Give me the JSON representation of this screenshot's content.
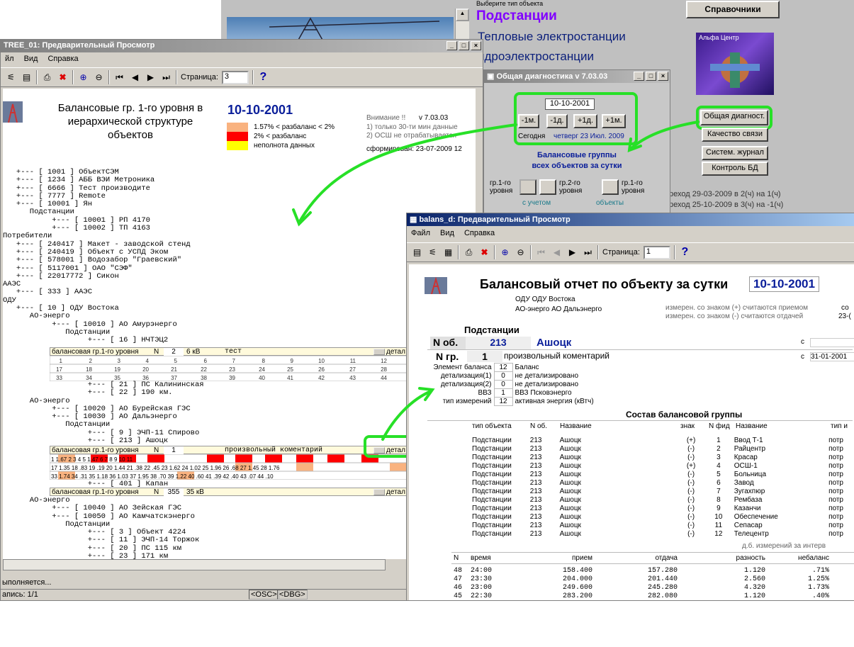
{
  "bg_menu": {
    "hint": "Выберите тип объекта",
    "items": [
      "Подстанции",
      "Тепловые электростанции",
      "идроэлектростанции"
    ],
    "directory_btn": "Справочники",
    "logo_caption": "Альфа Центр"
  },
  "right_buttons": [
    "Общая диагност.",
    "Качество связи",
    "Систем. журнал",
    "Контроль БД"
  ],
  "dst_notes": [
    "реход 29-03-2009 в 2(ч) на 1(ч)",
    "реход 25-10-2009 в 3(ч) на -1(ч)"
  ],
  "diag": {
    "title": "Общая диагностика  v 7.03.03",
    "date": "10-10-2001",
    "nav": [
      "-1м.",
      "-1д.",
      "+1д.",
      "+1м."
    ],
    "today_label": "Сегодня",
    "today_value": "четверг 23 Июл. 2009",
    "groups_title": "Балансовые группы",
    "groups_sub": "всех объектов за сутки",
    "levels": [
      "гр.1-го уровня",
      "гр.2-го уровня",
      "гр.1-го уровня"
    ],
    "links": [
      "с учетом",
      "объекты"
    ]
  },
  "tree": {
    "title": "TREE_01: Предварительный Просмотр",
    "menu": [
      "йл",
      "Вид",
      "Справка"
    ],
    "page_label": "Страница:",
    "page": "3",
    "report_title": "Балансовые гр. 1-го уровня в иерархической структуре объектов",
    "date": "10-10-2001",
    "legend": [
      "1.57% < разбаланс < 2%",
      "2% < разбаланс",
      "неполнота данных"
    ],
    "attention": "Внимание !!",
    "version": "v 7.03.03",
    "notes": [
      "1) только 30-ти мин данные",
      "2) ОСШ не отрабатывается"
    ],
    "formed": "сформирован: 23-07-2009 12",
    "lines_top": "   +--- [ 1001 ] ОбъектСЭМ\n   +--- [ 1234 ] АББ ВЭИ Метроника\n   +--- [ 6666 ] Тест производите\n   +--- [ 7777 ] Remote\n   +--- [ 10001 ] Ян\n      Подстанции\n           +--- [ 10001 ] РП 4170\n           +--- [ 10002 ] ТП 4163\nПотребители\n   +--- [ 240417 ] Макет - заводской стенд\n   +--- [ 240419 ] Объект с УСПД Эком\n   +--- [ 578001 ] Водозабор \"Граевский\"\n   +--- [ 5117001 ] ОАО \"СЭФ\"\n   +--- [ 22017772 ] Сикон\nААЭС\n   +--- [ 333 ] ААЭС\nОДУ\n   +--- [ 10 ] ОДУ Востока\n      АО-энерго\n           +--- [ 10010 ] АО Амурэнерго\n              Подстанции\n                   +--- [ 16 ] НЧТЭЦ2",
    "lines_mid": "                   +--- [ 21 ] ПС Калининская\n                   +--- [ 22 ] 190 км.\n      АО-энерго\n           +--- [ 10020 ] АО Бурейская ГЭС\n           +--- [ 10030 ] АО Дальэнерго\n              Подстанции\n                   +--- [ 9 ] ЭЧП-11 Спирово\n                   +--- [ 213 ] Ашоцк",
    "lines_low": "                   +--- [ 401 ] Капан",
    "lines_bot": "      АО-энерго\n           +--- [ 10040 ] АО Зейская ГЭС\n           +--- [ 10050 ] АО Камчатскэнерго\n              Подстанции\n                   +--- [ 3 ] Объект 4224\n                   +--- [ 11 ] ЭЧП-14 Торжок\n                   +--- [ 20 ] ПС 115 км\n                   +--- [ 23 ] 171 км",
    "band1": {
      "label": "балансовая гр.1-го уровня",
      "n": "2",
      "v": "6 кВ",
      "txt": "тест",
      "btn": "детал"
    },
    "band2": {
      "label": "балансовая гр.1-го уровня",
      "n": "1",
      "v": "",
      "txt": "произвольный коментарий",
      "btn": "детал"
    },
    "band3": {
      "label": "балансовая гр.1-го уровня",
      "n": "355",
      "v": "35 кВ",
      "btn": "детал"
    },
    "status": [
      "ыполняется...",
      "апись: 1/1",
      "<OSC>",
      "<DBG>"
    ]
  },
  "bal": {
    "title": "balans_d: Предварительный Просмотр",
    "menu": [
      "Файл",
      "Вид",
      "Справка"
    ],
    "page_label": "Страница:",
    "page": "1",
    "report_title": "Балансовый отчет по объекту за сутки",
    "date": "10-10-2001",
    "odu": "ОДУ  ОДУ Востока",
    "ao": "АО-энерго  АО Дальэнерго",
    "sign_notes": [
      "измерен. со знаком (+) считаются приемом",
      "измерен. со знаком (-) считаются отдачей"
    ],
    "cut_right": [
      "со",
      "23-("
    ],
    "kind": "Подстанции",
    "nob_label": "N об.",
    "nob": "213",
    "name": "Ашоцк",
    "ngr_label": "N гр.",
    "ngr": "1",
    "comment": "произвольный коментарий",
    "c_label": "с",
    "c_date": "31-01-2001",
    "params": [
      [
        "Элемент баланса",
        "12",
        "Баланс"
      ],
      [
        "детализация(1)",
        "0",
        "не детализировано"
      ],
      [
        "детализация(2)",
        "0",
        "не детализировано"
      ],
      [
        "ВВЗ",
        "1",
        "ВВЗ Псковэнерго"
      ],
      [
        "тип измерений",
        "12",
        "активная энергия (кВтч)"
      ]
    ],
    "comp_title": "Состав балансовой группы",
    "comp_headers": [
      "тип объекта",
      "N об.",
      "Название",
      "знак",
      "N фид",
      "Название",
      "тип и"
    ],
    "comp_rows": [
      [
        "Подстанции",
        "213",
        "Ашоцк",
        "(+)",
        "1",
        "Ввод Т-1",
        "потр"
      ],
      [
        "Подстанции",
        "213",
        "Ашоцк",
        "(-)",
        "2",
        "Райцентр",
        "потр"
      ],
      [
        "Подстанции",
        "213",
        "Ашоцк",
        "(-)",
        "3",
        "Красар",
        "потр"
      ],
      [
        "Подстанции",
        "213",
        "Ашоцк",
        "(+)",
        "4",
        "ОСШ-1",
        "потр"
      ],
      [
        "Подстанции",
        "213",
        "Ашоцк",
        "(-)",
        "5",
        "Больница",
        "потр"
      ],
      [
        "Подстанции",
        "213",
        "Ашоцк",
        "(-)",
        "6",
        "Завод",
        "потр"
      ],
      [
        "Подстанции",
        "213",
        "Ашоцк",
        "(-)",
        "7",
        "Зугахпюр",
        "потр"
      ],
      [
        "Подстанции",
        "213",
        "Ашоцк",
        "(-)",
        "8",
        "Рембаза",
        "потр"
      ],
      [
        "Подстанции",
        "213",
        "Ашоцк",
        "(-)",
        "9",
        "Казанчи",
        "потр"
      ],
      [
        "Подстанции",
        "213",
        "Ашоцк",
        "(-)",
        "10",
        "Обеспечение",
        "потр"
      ],
      [
        "Подстанции",
        "213",
        "Ашоцк",
        "(-)",
        "11",
        "Сепасар",
        "потр"
      ],
      [
        "Подстанции",
        "213",
        "Ашоцк",
        "(-)",
        "12",
        "Телецентр",
        "потр"
      ]
    ],
    "interval_note": "д.б. измерений за интерв",
    "meas_headers": [
      "N",
      "время",
      "прием",
      "отдача",
      "разность",
      "небаланс"
    ],
    "meas_rows": [
      [
        "48",
        "24:00",
        "158.400",
        "157.280",
        "1.120",
        ".71%"
      ],
      [
        "47",
        "23:30",
        "204.000",
        "201.440",
        "2.560",
        "1.25%"
      ],
      [
        "46",
        "23:00",
        "249.600",
        "245.280",
        "4.320",
        "1.73%"
      ],
      [
        "45",
        "22:30",
        "283.200",
        "282.080",
        "1.120",
        ".40%"
      ]
    ]
  },
  "colors": {
    "highlight": "#27e027",
    "title_active": "#0a246a",
    "date_blue": "#0a1e9a",
    "legend_orange": "#f9b27f",
    "legend_red": "#ff0000",
    "legend_yellow": "#ffff00"
  }
}
